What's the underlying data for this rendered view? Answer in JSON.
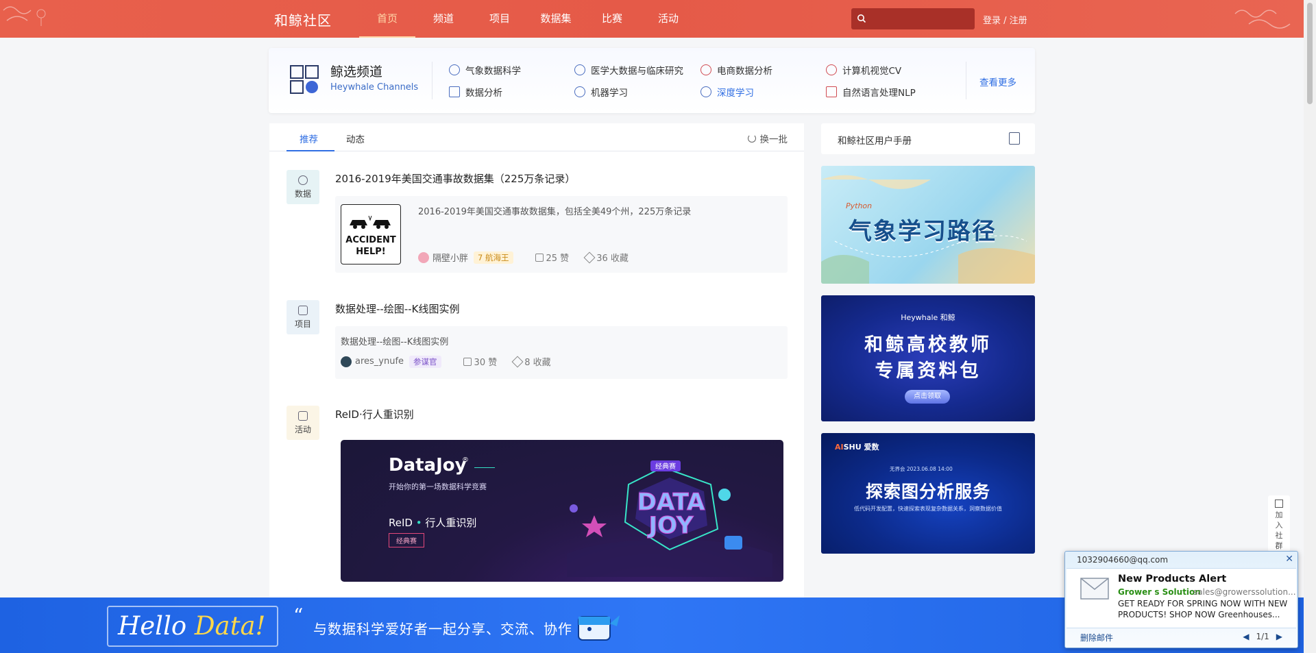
{
  "header": {
    "logo": "和鲸社区",
    "nav": [
      {
        "label": "首页",
        "active": true
      },
      {
        "label": "频道",
        "active": false
      },
      {
        "label": "项目",
        "active": false
      },
      {
        "label": "数据集",
        "active": false
      },
      {
        "label": "比赛",
        "active": false
      },
      {
        "label": "活动",
        "active": false
      }
    ],
    "search_placeholder": "",
    "login": "登录 / 注册",
    "accent": "#e55a48"
  },
  "channels": {
    "title": "鲸选频道",
    "subtitle": "Heywhale Channels",
    "items": [
      {
        "label": "气象数据科学",
        "icon": "globe-icon"
      },
      {
        "label": "医学大数据与临床研究",
        "icon": "medical-cross-icon"
      },
      {
        "label": "电商数据分析",
        "icon": "tag-icon"
      },
      {
        "label": "计算机视觉CV",
        "icon": "eye-icon"
      },
      {
        "label": "数据分析",
        "icon": "line-chart-icon"
      },
      {
        "label": "机器学习",
        "icon": "brain-icon"
      },
      {
        "label": "深度学习",
        "icon": "network-icon"
      },
      {
        "label": "自然语言处理NLP",
        "icon": "text-icon"
      }
    ],
    "more": "查看更多"
  },
  "feed": {
    "tabs": [
      {
        "label": "推荐",
        "active": true
      },
      {
        "label": "动态",
        "active": false
      }
    ],
    "refresh": "换一批",
    "posts": [
      {
        "type": "数据",
        "title": "2016-2019年美国交通事故数据集（225万条记录）",
        "desc": "2016-2019年美国交通事故数据集，包括全美49个州，225万条记录",
        "thumb_line1": "ACCIDENT",
        "thumb_line2": "HELP!",
        "user": "隔壁小胖",
        "level_num": "7",
        "level": "航海王",
        "likes": "25 赞",
        "stars": "36 收藏"
      },
      {
        "type": "项目",
        "title": "数据处理--绘图--K线图实例",
        "desc": "数据处理--绘图--K线图实例",
        "user": "ares_ynufe",
        "level": "参谋官",
        "likes": "30 赞",
        "stars": "8 收藏"
      },
      {
        "type": "活动",
        "title": "ReID·行人重识别",
        "banner": {
          "brand": "DataJoy",
          "reg": "®",
          "tagline": "开始你的第一场数据科学竞赛",
          "name_pre": "ReID",
          "name_dot": " • ",
          "name_post": "行人重识别",
          "tag": "经典赛",
          "art_badge": "经典赛",
          "art_text1": "DATA",
          "art_text2": "JOY"
        }
      }
    ]
  },
  "sidebar": {
    "manual": "和鲸社区用户手册",
    "ad1": {
      "python": "Python",
      "title": "气象学习路径"
    },
    "ad2": {
      "brand": "Heywhale 和鲸",
      "line1": "和鲸高校教师",
      "line2": "专属资料包",
      "button": "点击领取"
    },
    "ad3": {
      "brand_hi": "AI",
      "brand": "SHU 爱数",
      "event": "无界会  2023.06.08 14:00",
      "title": "探索图分析服务",
      "desc": "低代码开发配置，快速探索表现复杂数据关系，洞察数据价值"
    },
    "join": [
      "加",
      "入",
      "社",
      "群"
    ]
  },
  "bottom": {
    "hello": "Hello ",
    "data": "Data!",
    "quote": "“",
    "slogan": "与数据科学爱好者一起分享、交流、协作"
  },
  "notification": {
    "email": "1032904660@qq.com",
    "subject": "New Products Alert",
    "from": "Grower s Solution",
    "address": "sales@growerssolution...",
    "preview": "GET READY FOR SPRING NOW WITH NEW PRODUCTS!  SHOP NOW   Greenhouses...",
    "delete": "删除邮件",
    "page": "1/1"
  }
}
